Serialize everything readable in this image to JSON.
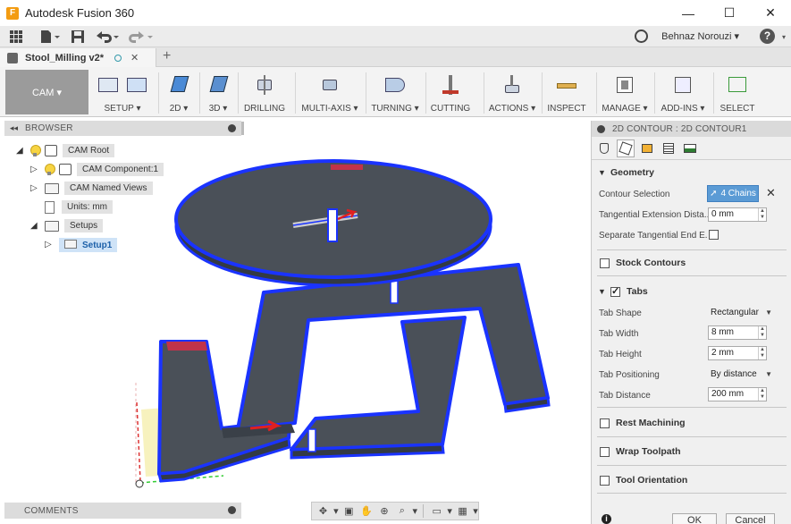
{
  "app": {
    "title": "Autodesk Fusion 360",
    "icon_letter": "F"
  },
  "window_controls": {
    "minimize": "—",
    "maximize": "☐",
    "close": "✕"
  },
  "quick_access": {
    "user_name": "Behnaz Norouzi ▾",
    "help_label": "?"
  },
  "document_tab": {
    "name": "Stool_Milling v2*",
    "close": "✕",
    "new_tab": "+"
  },
  "ribbon": {
    "workspace": "CAM ▾",
    "groups": [
      {
        "id": "setup",
        "label": "SETUP ▾"
      },
      {
        "id": "2d",
        "label": "2D ▾"
      },
      {
        "id": "3d",
        "label": "3D ▾"
      },
      {
        "id": "drilling",
        "label": "DRILLING"
      },
      {
        "id": "multi-axis",
        "label": "MULTI-AXIS ▾"
      },
      {
        "id": "turning",
        "label": "TURNING ▾"
      },
      {
        "id": "cutting",
        "label": "CUTTING"
      },
      {
        "id": "actions",
        "label": "ACTIONS ▾"
      },
      {
        "id": "inspect",
        "label": "INSPECT"
      },
      {
        "id": "manage",
        "label": "MANAGE ▾"
      },
      {
        "id": "add-ins",
        "label": "ADD-INS ▾"
      },
      {
        "id": "select",
        "label": "SELECT"
      }
    ]
  },
  "browser": {
    "title": "BROWSER",
    "tree": [
      {
        "label": "CAM Root"
      },
      {
        "label": "CAM Component:1"
      },
      {
        "label": "CAM Named Views"
      },
      {
        "label": "Units: mm"
      },
      {
        "label": "Setups"
      },
      {
        "label": "Setup1"
      }
    ]
  },
  "comments": {
    "title": "COMMENTS"
  },
  "panel": {
    "title": "2D CONTOUR : 2D CONTOUR1",
    "sections": {
      "geometry": "Geometry",
      "stock_contours": "Stock Contours",
      "tabs": "Tabs",
      "rest_machining": "Rest Machining",
      "wrap_toolpath": "Wrap Toolpath",
      "tool_orientation": "Tool Orientation"
    },
    "fields": {
      "contour_selection": {
        "label": "Contour Selection",
        "value": "4 Chains"
      },
      "tangential_extension": {
        "label": "Tangential Extension Dista...",
        "value": "0 mm"
      },
      "separate_tangential": {
        "label": "Separate Tangential End E..."
      },
      "tab_shape": {
        "label": "Tab Shape",
        "value": "Rectangular"
      },
      "tab_width": {
        "label": "Tab Width",
        "value": "8 mm"
      },
      "tab_height": {
        "label": "Tab Height",
        "value": "2 mm"
      },
      "tab_positioning": {
        "label": "Tab Positioning",
        "value": "By distance"
      },
      "tab_distance": {
        "label": "Tab Distance",
        "value": "200 mm"
      }
    },
    "buttons": {
      "ok": "OK",
      "cancel": "Cancel",
      "info": "i"
    }
  },
  "colors": {
    "accent": "#5b9bd5",
    "selected_edge": "#1a33ff",
    "body": "#4a5058",
    "workspace_btn": "#9b9b9b"
  }
}
